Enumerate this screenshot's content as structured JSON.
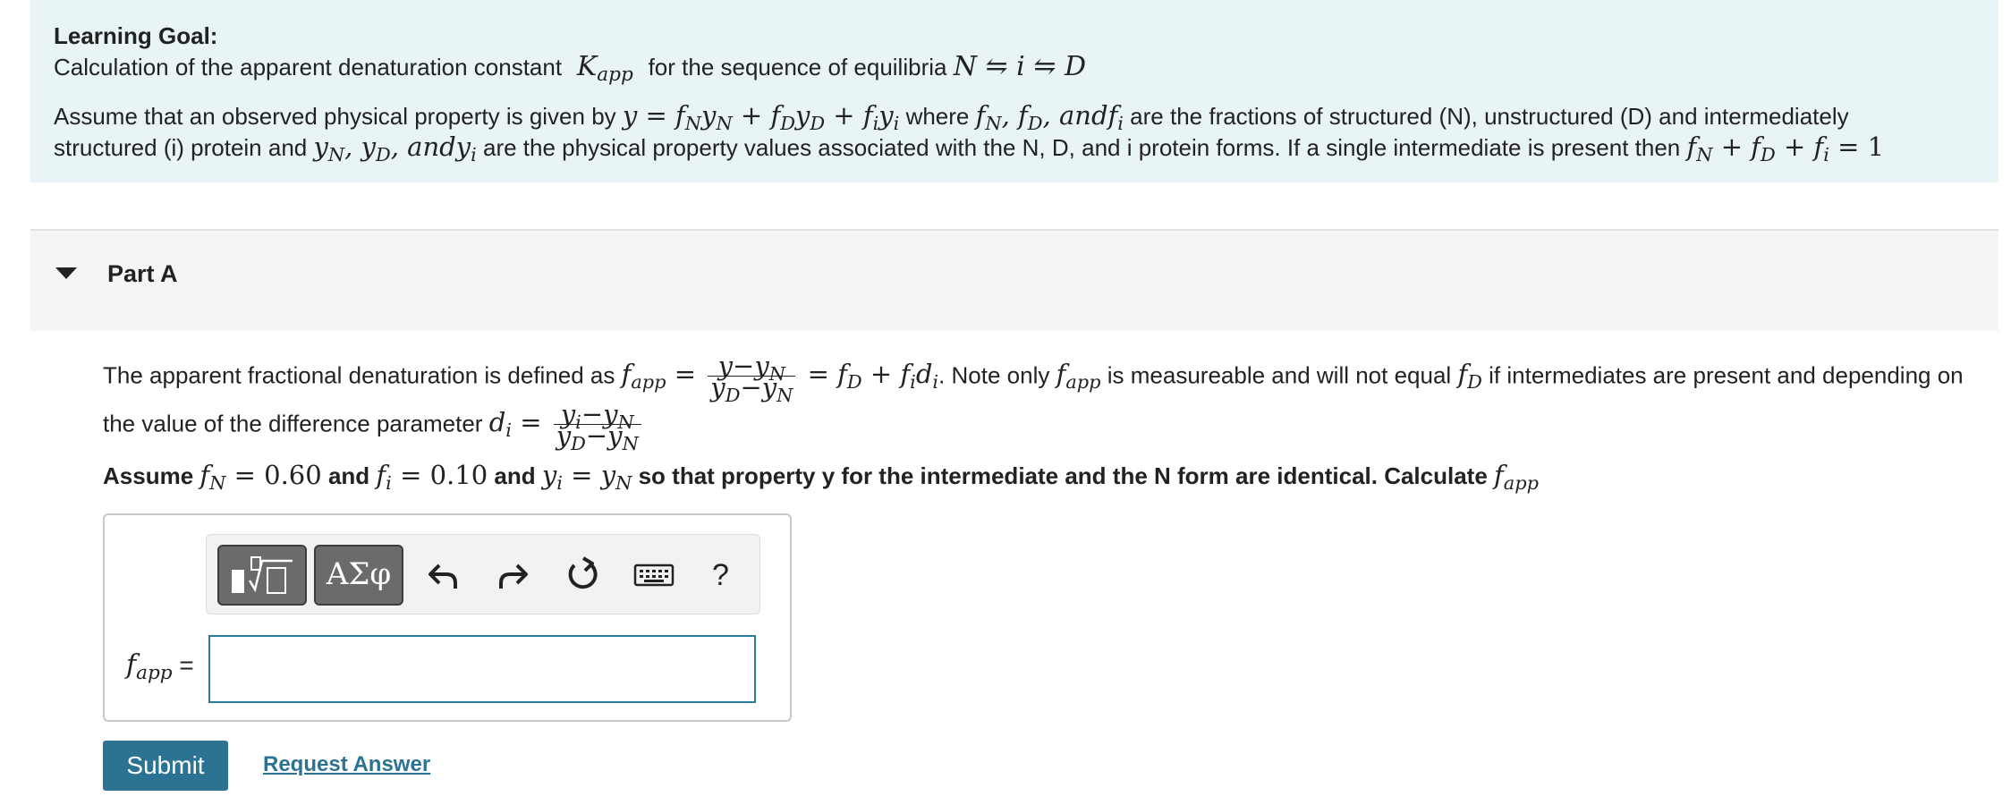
{
  "goal": {
    "heading": "Learning Goal:",
    "subtitle_pre": "Calculation of the apparent denaturation constant",
    "subtitle_post": "for the sequence of equilibria",
    "para_1": "Assume that an observed physical property is given by",
    "para_2": "where",
    "para_3": "are the fractions of structured (N), unstructured (D) and intermediately",
    "para_4": "structured (i) protein and",
    "para_5": "are the physical property values associated with the N, D, and i protein forms. If a single intermediate is present then"
  },
  "part": {
    "title": "Part A"
  },
  "question": {
    "line1_a": "The apparent fractional denaturation is defined as",
    "line1_b": ". Note only",
    "line1_c": "is measureable and will not equal",
    "line1_d": "if intermediates are present and depending on",
    "line2": "the value of the difference parameter",
    "line3_a": "Assume",
    "line3_b": "and",
    "line3_c": "and",
    "line3_d": "so that property y for the intermediate and the N form are identical.  Calculate",
    "fN": "0.60",
    "fi": "0.10"
  },
  "toolbar": {
    "greek_label": "ΑΣφ",
    "help_label": "?"
  },
  "answer": {
    "label_suffix": "="
  },
  "actions": {
    "submit_label": "Submit",
    "request_label": "Request Answer"
  }
}
